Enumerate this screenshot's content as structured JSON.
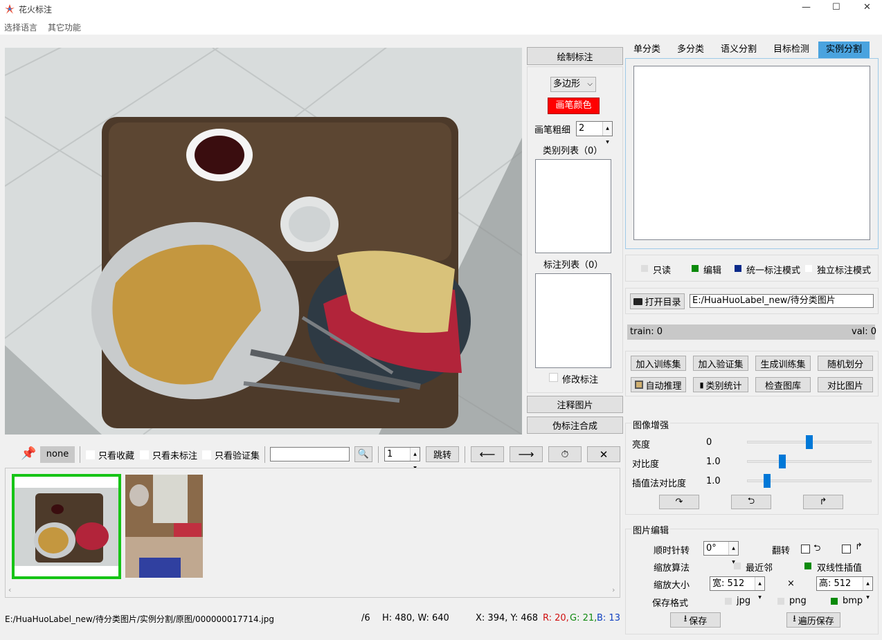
{
  "app": {
    "title": "花火标注",
    "minimize": "—",
    "maximize": "☐",
    "close": "✕"
  },
  "menu": {
    "language": "选择语言",
    "other": "其它功能"
  },
  "draw_panel": {
    "header": "绘制标注",
    "shape_select": "多边形",
    "pen_color_label": "画笔颜色",
    "pen_color": "#ff0000",
    "pen_width_label": "画笔粗细",
    "pen_width": "2",
    "class_list_label": "类别列表（0）",
    "label_list_label": "标注列表（0）",
    "modify_label": "修改标注",
    "annotate_image": "注释图片",
    "pseudo_label": "伪标注合成"
  },
  "tabs": [
    "单分类",
    "多分类",
    "语义分割",
    "目标检测",
    "实例分割"
  ],
  "active_tab_color": "#4aa3df",
  "modes": {
    "readonly": "只读",
    "edit": "编辑",
    "unified": "统一标注模式",
    "independent": "独立标注模式"
  },
  "dir": {
    "open_button": "打开目录",
    "path": "E:/HuaHuoLabel_new/待分类图片"
  },
  "counts": {
    "train": "train: 0",
    "val": "val: 0"
  },
  "actions": {
    "add_train": "加入训练集",
    "add_val": "加入验证集",
    "gen_train": "生成训练集",
    "random_split": "随机划分",
    "auto_infer": "自动推理",
    "class_stats": "类别统计",
    "check_gallery": "检查图库",
    "compare": "对比图片"
  },
  "enhance": {
    "title": "图像增强",
    "brightness_label": "亮度",
    "brightness": "0",
    "brightness_level": 0.5,
    "contrast_label": "对比度",
    "contrast": "1.0",
    "contrast_level": 0.27,
    "interp_label": "插值法对比度",
    "interp": "1.0",
    "interp_level": 0.14
  },
  "edit": {
    "title": "图片编辑",
    "rotate_label": "顺时针转",
    "rotate_value": "0°",
    "flip_label": "翻转",
    "scale_algo_label": "缩放算法",
    "nearest": "最近邻",
    "bilinear": "双线性插值",
    "size_label": "缩放大小",
    "width": "宽: 512",
    "times": "×",
    "height": "高: 512",
    "format_label": "保存格式",
    "jpg": "jpg",
    "png": "png",
    "bmp": "bmp",
    "save": "保存",
    "batch_save": "遍历保存"
  },
  "toolbar": {
    "none": "none",
    "only_fav": "只看收藏",
    "only_unlabeled": "只看未标注",
    "only_val": "只看验证集",
    "search_value": "",
    "page": "1",
    "jump": "跳转"
  },
  "status": {
    "path": "E:/HuaHuoLabel_new/待分类图片/实例分割/原图/000000017714.jpg",
    "count": "/6",
    "size": "H: 480, W: 640",
    "coords": "X: 394, Y: 468",
    "r": "R: 20,",
    "g": "G: 21,",
    "b": "B: 13"
  }
}
